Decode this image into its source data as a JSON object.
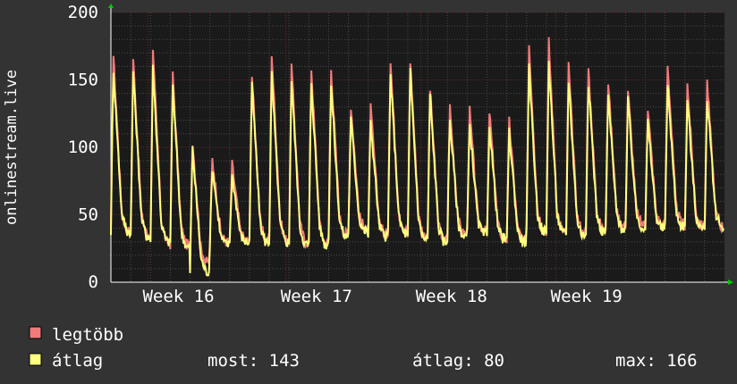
{
  "chart_data": {
    "type": "line",
    "ylabel": "onlinestream.live",
    "ylim": [
      0,
      200
    ],
    "yticks": [
      "0",
      "50",
      "100",
      "150",
      "200"
    ],
    "xticks": [
      {
        "label": "Week 16",
        "pos": 0.18
      },
      {
        "label": "Week 17",
        "pos": 0.405
      },
      {
        "label": "Week 18",
        "pos": 0.625
      },
      {
        "label": "Week 19",
        "pos": 0.845
      }
    ],
    "days": 31,
    "grid": true,
    "colors": {
      "background": "#333333",
      "plot": "#1a1a1a",
      "major_grid": "#6b2a2a",
      "minor_grid": "#4a4a4a",
      "axis": "#ffffff",
      "text": "#ffffff",
      "max": "#f27a7a",
      "avg": "#ffff80",
      "arrow": "#00cc00"
    },
    "series": [
      {
        "name": "legtöbb",
        "color": "#f27a7a",
        "daily_peaks": [
          170,
          168,
          172,
          155,
          106,
          92,
          88,
          155,
          172,
          162,
          160,
          160,
          132,
          130,
          166,
          166,
          145,
          131,
          128,
          128,
          120,
          178,
          180,
          162,
          160,
          150,
          144,
          130,
          164,
          148,
          150
        ],
        "daily_lows": [
          38,
          36,
          30,
          28,
          15,
          30,
          31,
          31,
          32,
          30,
          29,
          36,
          40,
          36,
          38,
          35,
          31,
          36,
          38,
          33,
          31,
          40,
          38,
          37,
          40,
          42,
          43,
          42,
          44,
          42,
          42
        ]
      },
      {
        "name": "átlag",
        "color": "#ffff80",
        "daily_peaks": [
          160,
          158,
          160,
          148,
          100,
          86,
          80,
          148,
          155,
          152,
          150,
          148,
          122,
          120,
          155,
          158,
          140,
          122,
          118,
          118,
          112,
          160,
          165,
          152,
          150,
          140,
          135,
          120,
          150,
          136,
          138
        ],
        "daily_lows": [
          38,
          34,
          30,
          26,
          8,
          28,
          30,
          30,
          30,
          28,
          28,
          34,
          38,
          34,
          36,
          32,
          30,
          34,
          36,
          32,
          30,
          38,
          36,
          35,
          38,
          40,
          41,
          40,
          42,
          40,
          42
        ]
      }
    ],
    "legend": {
      "placement": "bottom-left",
      "items": [
        {
          "label": "legtöbb",
          "color": "#f27a7a"
        },
        {
          "label": "átlag",
          "color": "#ffff80"
        }
      ]
    },
    "stats": {
      "most": "most: 143",
      "atlag": "átlag: 80",
      "max": "max: 166"
    }
  }
}
